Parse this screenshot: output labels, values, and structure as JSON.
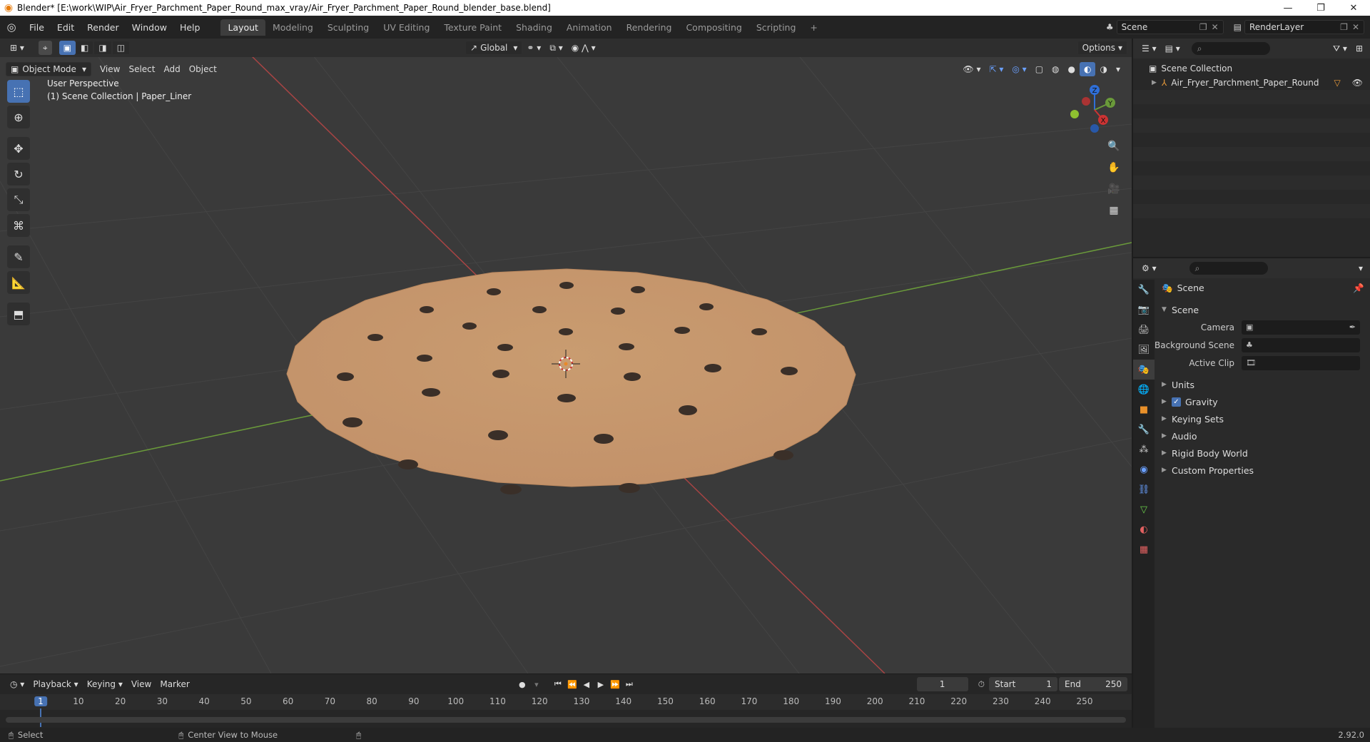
{
  "titlebar": {
    "title": "Blender* [E:\\work\\WIP\\Air_Fryer_Parchment_Paper_Round_max_vray/Air_Fryer_Parchment_Paper_Round_blender_base.blend]",
    "minimize": "—",
    "maximize": "❐",
    "close": "✕"
  },
  "menu": [
    "File",
    "Edit",
    "Render",
    "Window",
    "Help"
  ],
  "workspaces": [
    "Layout",
    "Modeling",
    "Sculpting",
    "UV Editing",
    "Texture Paint",
    "Shading",
    "Animation",
    "Rendering",
    "Compositing",
    "Scripting"
  ],
  "workspace_add": "+",
  "scene": {
    "name": "Scene",
    "view_layer": "RenderLayer"
  },
  "viewport": {
    "mode": "Object Mode",
    "menus": [
      "View",
      "Select",
      "Add",
      "Object"
    ],
    "transform_orientation": "Global",
    "options": "Options",
    "perspective": "User Perspective",
    "collection_info": "(1) Scene Collection | Paper_Liner",
    "gizmo": {
      "z": "Z",
      "y": "Y",
      "x": "X"
    }
  },
  "outliner": {
    "root": "Scene Collection",
    "items": [
      "Air_Fryer_Parchment_Paper_Round"
    ]
  },
  "properties": {
    "context": "Scene",
    "panel": "Scene",
    "fields": [
      {
        "label": "Camera",
        "value": ""
      },
      {
        "label": "Background Scene",
        "value": ""
      },
      {
        "label": "Active Clip",
        "value": ""
      }
    ],
    "sections": [
      "Units",
      "Gravity",
      "Keying Sets",
      "Audio",
      "Rigid Body World",
      "Custom Properties"
    ]
  },
  "timeline": {
    "menus": [
      "Playback",
      "Keying",
      "View",
      "Marker"
    ],
    "current_frame": "1",
    "start_label": "Start",
    "start": "1",
    "end_label": "End",
    "end": "250",
    "ticks": [
      "1",
      "10",
      "20",
      "30",
      "40",
      "50",
      "60",
      "70",
      "80",
      "90",
      "100",
      "110",
      "120",
      "130",
      "140",
      "150",
      "160",
      "170",
      "180",
      "190",
      "200",
      "210",
      "220",
      "230",
      "240",
      "250"
    ]
  },
  "statusbar": {
    "select": "Select",
    "center_view": "Center View to Mouse",
    "version": "2.92.0"
  },
  "colors": {
    "accent": "#4772b3",
    "paper": "#c8996b",
    "axis_x": "#a84444",
    "axis_y": "#6a9a3a"
  }
}
